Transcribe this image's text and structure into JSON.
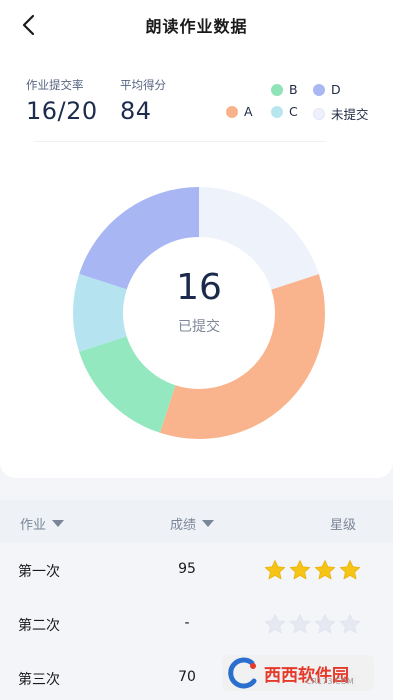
{
  "header": {
    "title": "朗读作业数据"
  },
  "stats": [
    {
      "label": "作业提交率",
      "value": "16/20"
    },
    {
      "label": "平均得分",
      "value": "84"
    }
  ],
  "legend": [
    {
      "label": "B",
      "color": "#8ee3b9"
    },
    {
      "label": "D",
      "color": "#a9b8f2"
    },
    {
      "label": "A",
      "color": "#f8b28c"
    },
    {
      "label": "C",
      "color": "#b8e6ef"
    },
    {
      "label": "未提交",
      "color": "#eef1fb"
    }
  ],
  "chart_data": {
    "type": "pie",
    "center_value": "16",
    "center_label": "已提交",
    "slices": [
      {
        "label": "未提交",
        "value": 4,
        "color": "#eef2fb"
      },
      {
        "label": "A",
        "value": 7,
        "color": "#f9b48d"
      },
      {
        "label": "B",
        "value": 3,
        "color": "#93e8bf"
      },
      {
        "label": "C",
        "value": 2,
        "color": "#b5e4f0"
      },
      {
        "label": "D",
        "value": 4,
        "color": "#a8b7f3"
      }
    ]
  },
  "table": {
    "columns": [
      {
        "label": "作业"
      },
      {
        "label": "成绩"
      },
      {
        "label": "星级"
      }
    ],
    "rows": [
      {
        "name": "第一次",
        "score": "95",
        "stars": 4
      },
      {
        "name": "第二次",
        "score": "-",
        "stars": 0
      },
      {
        "name": "第三次",
        "score": "70",
        "stars": 0
      }
    ]
  },
  "watermark": {
    "brand": "西西软件园",
    "site": "CR173.COM"
  }
}
